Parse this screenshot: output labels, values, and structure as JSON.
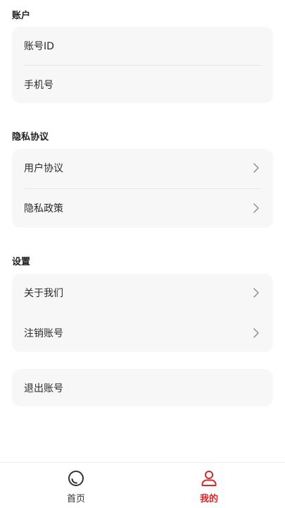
{
  "sections": {
    "account": {
      "title": "账户",
      "items": [
        {
          "label": "账号ID"
        },
        {
          "label": "手机号"
        }
      ]
    },
    "privacy": {
      "title": "隐私协议",
      "items": [
        {
          "label": "用户协议"
        },
        {
          "label": "隐私政策"
        }
      ]
    },
    "settings": {
      "title": "设置",
      "items": [
        {
          "label": "关于我们"
        },
        {
          "label": "注销账号"
        }
      ]
    },
    "logout": {
      "label": "退出账号"
    }
  },
  "tabbar": {
    "tabs": [
      {
        "label": "首页",
        "icon": "home-circle-icon",
        "active": false
      },
      {
        "label": "我的",
        "icon": "person-icon",
        "active": true
      }
    ],
    "active_color": "#d12a2a",
    "inactive_color": "#333333"
  }
}
